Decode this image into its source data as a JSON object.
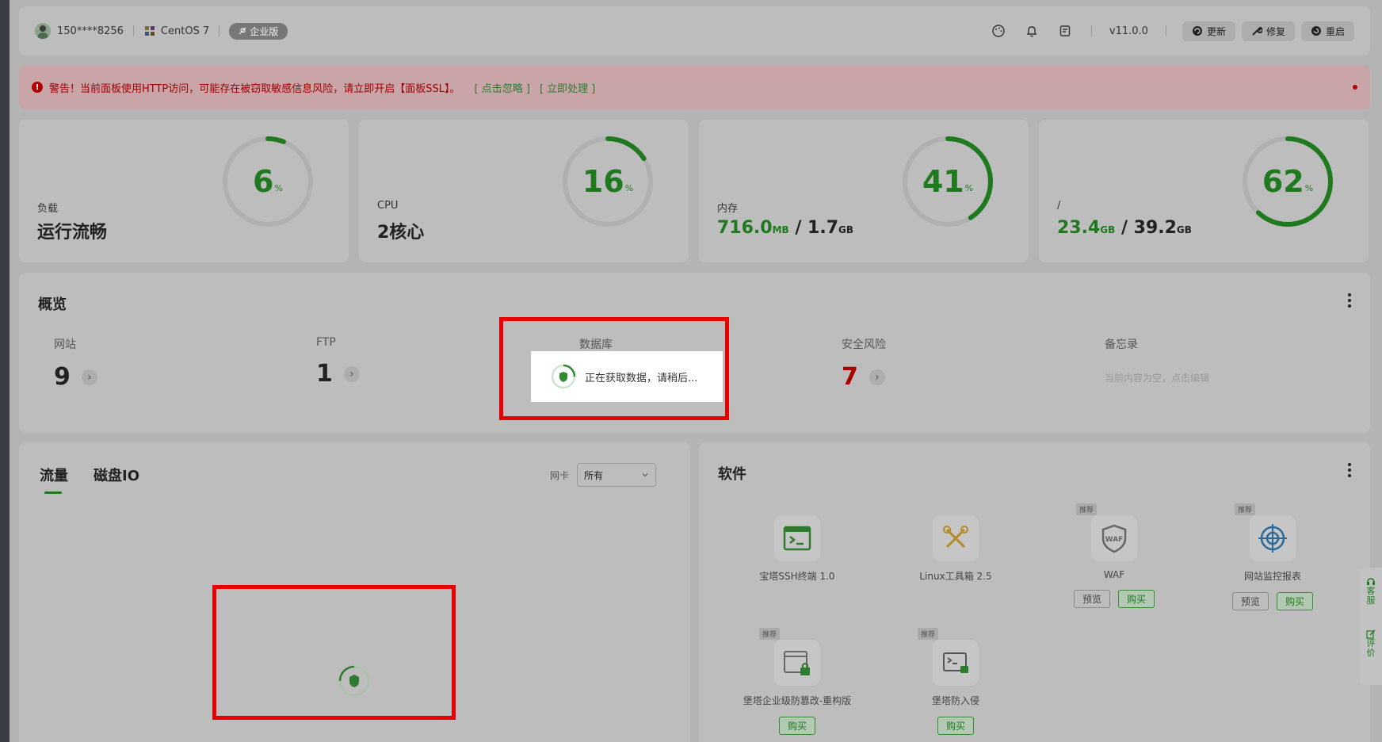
{
  "header": {
    "user": "150****8256",
    "os": "CentOS 7",
    "edition": "企业版",
    "version": "v11.0.0",
    "buttons": {
      "update": "更新",
      "repair": "修复",
      "restart": "重启"
    }
  },
  "warning": {
    "text": "警告！当前面板使用HTTP访问，可能存在被窃取敏感信息风险，请立即开启【面板SSL】。",
    "ignore": "[ 点击忽略 ]",
    "handle": "[ 立即处理 ]"
  },
  "stats": {
    "load": {
      "label": "负载",
      "value": "运行流畅",
      "percent": "6",
      "pct_sign": "%",
      "fraction": 0.06
    },
    "cpu": {
      "label": "CPU",
      "value": "2核心",
      "percent": "16",
      "pct_sign": "%",
      "fraction": 0.16
    },
    "memory": {
      "label": "内存",
      "used": "716.0",
      "used_unit": "MB",
      "sep": " / ",
      "total": "1.7",
      "total_unit": "GB",
      "percent": "41",
      "pct_sign": "%",
      "fraction": 0.41
    },
    "disk": {
      "label": "/",
      "used": "23.4",
      "used_unit": "GB",
      "sep": " / ",
      "total": "39.2",
      "total_unit": "GB",
      "percent": "62",
      "pct_sign": "%",
      "fraction": 0.62
    }
  },
  "overview": {
    "title": "概览",
    "website": {
      "label": "网站",
      "value": "9"
    },
    "ftp": {
      "label": "FTP",
      "value": "1"
    },
    "database": {
      "label": "数据库",
      "loading": "正在获取数据，请稍后..."
    },
    "security": {
      "label": "安全风险",
      "value": "7"
    },
    "memo": {
      "label": "备忘录",
      "hint": "当前内容为空，点击编辑"
    },
    "arrow": "›"
  },
  "traffic": {
    "tab_traffic": "流量",
    "tab_diskio": "磁盘IO",
    "nic_label": "网卡",
    "nic_value": "所有"
  },
  "software": {
    "title": "软件",
    "tag": "推荐",
    "preview": "预览",
    "buy": "购买",
    "items": [
      {
        "name": "宝塔SSH终端 1.0"
      },
      {
        "name": "Linux工具箱 2.5"
      },
      {
        "name": "WAF"
      },
      {
        "name": "网站监控报表"
      },
      {
        "name": "堡塔企业级防篡改-重构版"
      },
      {
        "name": "堡塔防入侵"
      }
    ]
  },
  "side_float": {
    "service": [
      "客",
      "服"
    ],
    "review": [
      "评",
      "价"
    ]
  },
  "colors": {
    "accent": "#1f7a1f",
    "danger": "#a80000",
    "highlight_box": "#e60000"
  }
}
